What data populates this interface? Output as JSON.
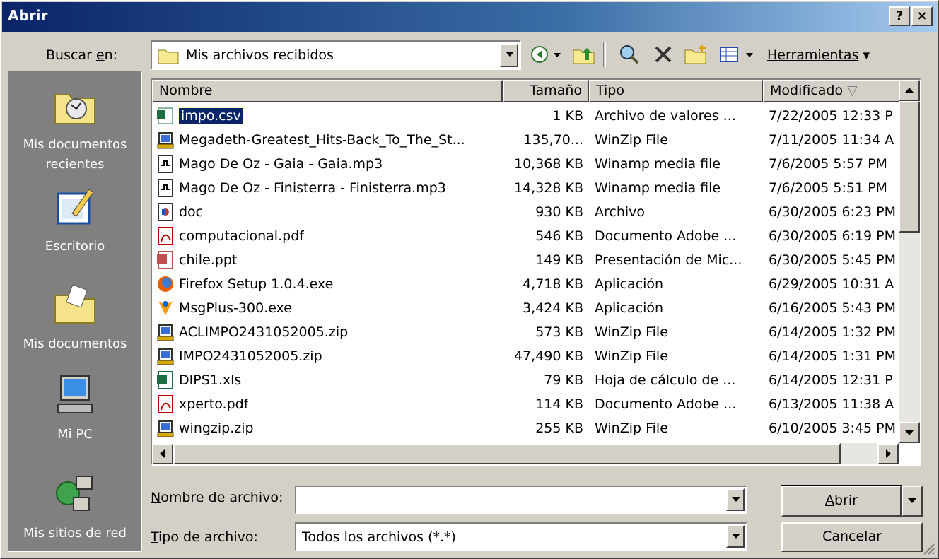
{
  "window": {
    "title": "Abrir",
    "help": "?",
    "close": "×"
  },
  "lookin": {
    "label_pre": "Buscar ",
    "label_u": "e",
    "label_post": "n:",
    "value": "Mis archivos recibidos"
  },
  "toolbar": {
    "tools_label": "Herramientas"
  },
  "places": [
    {
      "label": "Mis documentos recientes",
      "icon": "recent-docs-icon"
    },
    {
      "label": "Escritorio",
      "icon": "desktop-icon"
    },
    {
      "label": "Mis documentos",
      "icon": "my-documents-icon"
    },
    {
      "label": "Mi PC",
      "icon": "my-computer-icon"
    },
    {
      "label": "Mis sitios de red",
      "icon": "network-places-icon"
    }
  ],
  "columns": [
    "Nombre",
    "Tamaño",
    "Tipo",
    "Modificado"
  ],
  "files": [
    {
      "name": "impo.csv",
      "size": "1 KB",
      "type": "Archivo de valores ...",
      "modified": "7/22/2005 12:33 P",
      "icon": "csv"
    },
    {
      "name": "Megadeth-Greatest_Hits-Back_To_The_St...",
      "size": "135,70...",
      "type": "WinZip File",
      "modified": "7/11/2005 11:34 A",
      "icon": "zip"
    },
    {
      "name": "Mago De Oz - Gaia - Gaia.mp3",
      "size": "10,368 KB",
      "type": "Winamp media file",
      "modified": "7/6/2005 5:57 PM",
      "icon": "mp3"
    },
    {
      "name": "Mago De Oz - Finisterra - Finisterra.mp3",
      "size": "14,328 KB",
      "type": "Winamp media file",
      "modified": "7/6/2005 5:51 PM",
      "icon": "mp3"
    },
    {
      "name": "doc",
      "size": "930 KB",
      "type": "Archivo",
      "modified": "6/30/2005 6:23 PM",
      "icon": "doc"
    },
    {
      "name": "computacional.pdf",
      "size": "546 KB",
      "type": "Documento Adobe ...",
      "modified": "6/30/2005 6:19 PM",
      "icon": "pdf"
    },
    {
      "name": "chile.ppt",
      "size": "149 KB",
      "type": "Presentación de Mic...",
      "modified": "6/30/2005 5:45 PM",
      "icon": "ppt"
    },
    {
      "name": "Firefox Setup 1.0.4.exe",
      "size": "4,718 KB",
      "type": "Aplicación",
      "modified": "6/29/2005 10:31 A",
      "icon": "firefox"
    },
    {
      "name": "MsgPlus-300.exe",
      "size": "3,424 KB",
      "type": "Aplicación",
      "modified": "6/16/2005 5:43 PM",
      "icon": "msgplus"
    },
    {
      "name": "ACLIMPO2431052005.zip",
      "size": "573 KB",
      "type": "WinZip File",
      "modified": "6/14/2005 1:32 PM",
      "icon": "zip"
    },
    {
      "name": "IMPO2431052005.zip",
      "size": "47,490 KB",
      "type": "WinZip File",
      "modified": "6/14/2005 1:31 PM",
      "icon": "zip"
    },
    {
      "name": "DIPS1.xls",
      "size": "79 KB",
      "type": "Hoja de cálculo de ...",
      "modified": "6/14/2005 12:31 P",
      "icon": "xls"
    },
    {
      "name": "xperto.pdf",
      "size": "114 KB",
      "type": "Documento Adobe ...",
      "modified": "6/13/2005 11:38 A",
      "icon": "pdf"
    },
    {
      "name": "wingzip.zip",
      "size": "255 KB",
      "type": "WinZip File",
      "modified": "6/10/2005 3:45 PM",
      "icon": "zip"
    }
  ],
  "filename": {
    "label_u": "N",
    "label_post": "ombre de archivo:",
    "value": ""
  },
  "filetype": {
    "label_u": "T",
    "label_post": "ipo de archivo:",
    "value": "Todos los archivos (*.*)"
  },
  "buttons": {
    "open_u": "A",
    "open_post": "brir",
    "cancel": "Cancelar"
  },
  "colors": {
    "title_start": "#0a246a",
    "title_end": "#a6caf0",
    "face": "#d4d0c8",
    "places_bg": "#808080"
  }
}
